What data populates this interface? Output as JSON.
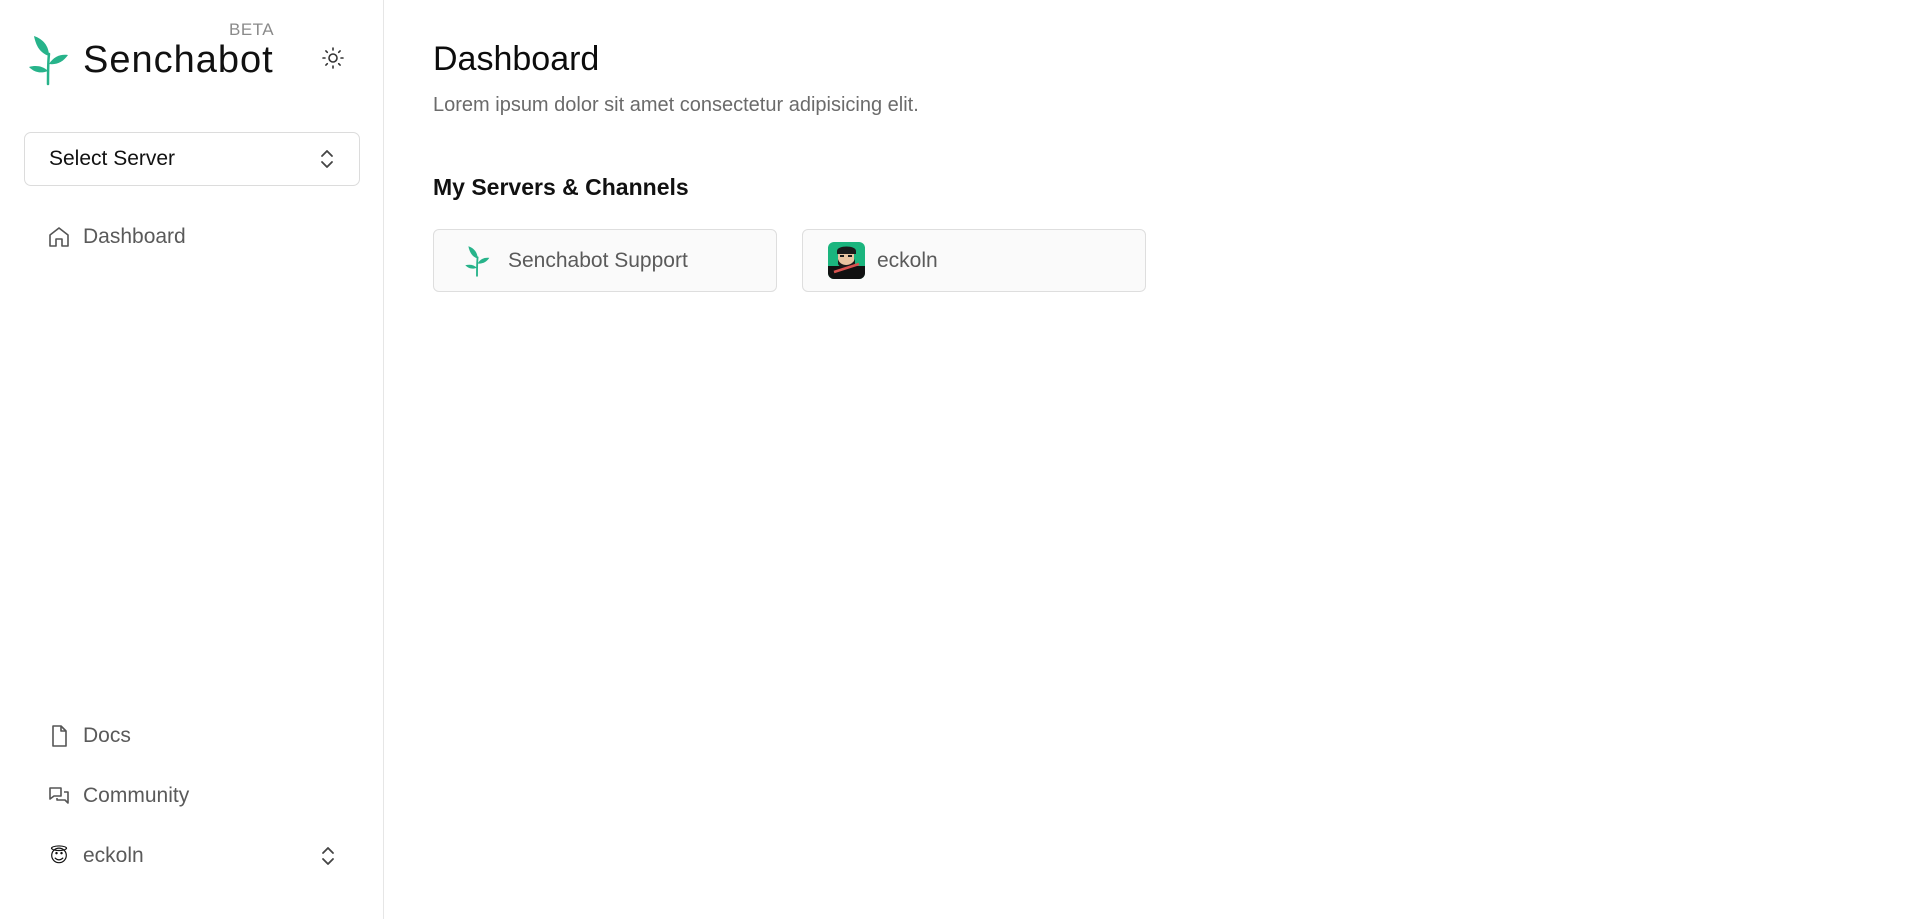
{
  "brand": {
    "name": "Senchabot",
    "badge": "BETA",
    "logo_icon": "sprout-icon",
    "accent_color": "#27b38a"
  },
  "theme_toggle": {
    "icon": "sun-icon"
  },
  "server_select": {
    "label": "Select Server",
    "icon": "chevron-up-down-icon"
  },
  "sidebar": {
    "top_items": [
      {
        "label": "Dashboard",
        "icon": "home-icon"
      }
    ],
    "bottom_items": [
      {
        "label": "Docs",
        "icon": "document-icon"
      },
      {
        "label": "Community",
        "icon": "chat-bubbles-icon"
      }
    ],
    "user": {
      "name": "eckoln",
      "emoji": "😇",
      "icon": "chevron-up-down-icon"
    }
  },
  "main": {
    "title": "Dashboard",
    "subtitle": "Lorem ipsum dolor sit amet consectetur adipisicing elit.",
    "section_title": "My Servers & Channels",
    "cards": [
      {
        "label": "Senchabot Support",
        "icon": "sprout-icon"
      },
      {
        "label": "eckoln",
        "icon": "avatar-image"
      }
    ]
  }
}
